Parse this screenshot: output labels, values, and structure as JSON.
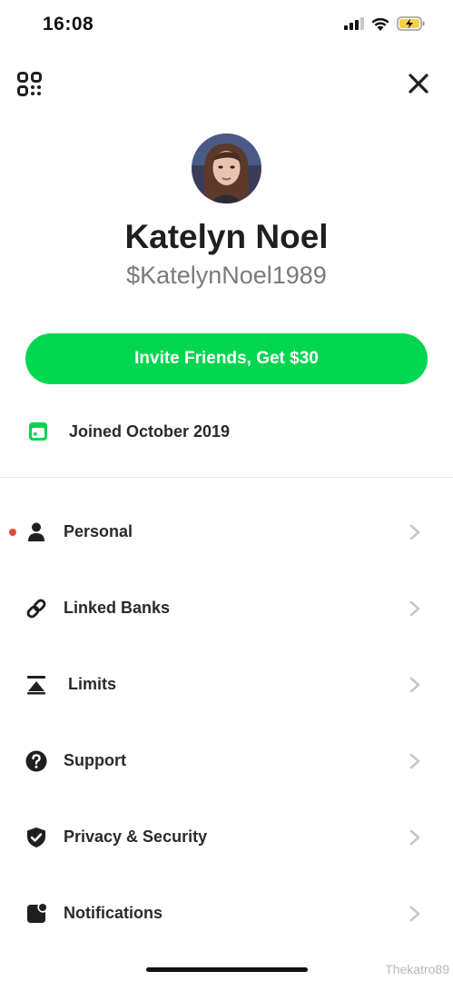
{
  "status_bar": {
    "time": "16:08"
  },
  "header": {
    "qr_icon": "qr-code-icon",
    "close_icon": "close-icon"
  },
  "profile": {
    "name": "Katelyn Noel",
    "cashtag": "$KatelynNoel1989",
    "avatar_icon": "avatar-photo"
  },
  "invite": {
    "label": "Invite Friends, Get $30",
    "color": "#00d64f"
  },
  "joined": {
    "label": "Joined October 2019",
    "icon": "calendar-icon"
  },
  "menu": [
    {
      "label": "Personal",
      "icon": "person-icon",
      "alert": true
    },
    {
      "label": "Linked Banks",
      "icon": "link-icon"
    },
    {
      "label": "Limits",
      "icon": "limits-icon"
    },
    {
      "label": "Support",
      "icon": "question-icon"
    },
    {
      "label": "Privacy & Security",
      "icon": "shield-icon"
    },
    {
      "label": "Notifications",
      "icon": "notification-icon"
    }
  ],
  "watermark": "Thekatro89",
  "colors": {
    "accent": "#00d64f",
    "alert": "#e8483f",
    "battery": "#f5d24b"
  }
}
